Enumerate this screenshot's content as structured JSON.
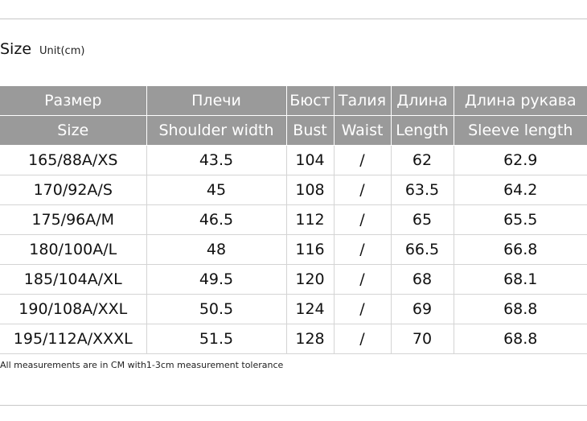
{
  "heading": {
    "title": "Size",
    "unit": "Unit(cm)"
  },
  "table": {
    "header_ru": [
      "Размер",
      "Плечи",
      "Бюст",
      "Талия",
      "Длина",
      "Длина рукава"
    ],
    "header_en": [
      "Size",
      "Shoulder width",
      "Bust",
      "Waist",
      "Length",
      "Sleeve length"
    ],
    "rows": [
      [
        "165/88A/XS",
        "43.5",
        "104",
        "/",
        "62",
        "62.9"
      ],
      [
        "170/92A/S",
        "45",
        "108",
        "/",
        "63.5",
        "64.2"
      ],
      [
        "175/96A/M",
        "46.5",
        "112",
        "/",
        "65",
        "65.5"
      ],
      [
        "180/100A/L",
        "48",
        "116",
        "/",
        "66.5",
        "66.8"
      ],
      [
        "185/104A/XL",
        "49.5",
        "120",
        "/",
        "68",
        "68.1"
      ],
      [
        "190/108A/XXL",
        "50.5",
        "124",
        "/",
        "69",
        "68.8"
      ],
      [
        "195/112A/XXXL",
        "51.5",
        "128",
        "/",
        "70",
        "68.8"
      ]
    ]
  },
  "note": "All measurements are in CM with1-3cm measurement tolerance"
}
